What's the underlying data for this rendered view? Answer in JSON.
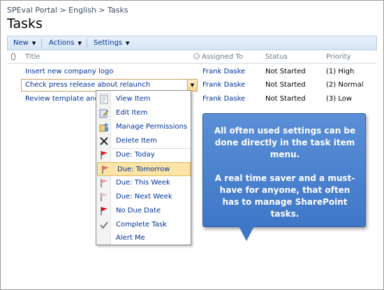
{
  "breadcrumb": "SPEval Portal > English > Tasks",
  "page_title": "Tasks",
  "toolbar": {
    "new_label": "New",
    "actions_label": "Actions",
    "settings_label": "Settings"
  },
  "columns": {
    "title": "Title",
    "assigned_to": "Assigned To",
    "status": "Status",
    "priority": "Priority"
  },
  "rows": [
    {
      "title": "Insert new company logo",
      "assigned_to": "Frank Daske",
      "status": "Not Started",
      "priority": "(1) High"
    },
    {
      "title": "Check press release about relaunch",
      "assigned_to": "Frank Daske",
      "status": "Not Started",
      "priority": "(2) Normal"
    },
    {
      "title": "Review template and CS",
      "assigned_to": "Frank Daske",
      "status": "Not Started",
      "priority": "(3) Low"
    }
  ],
  "menu": {
    "items": [
      {
        "label": "View Item",
        "icon": "view-icon"
      },
      {
        "label": "Edit Item",
        "icon": "edit-icon"
      },
      {
        "label": "Manage Permissions",
        "icon": "permissions-icon"
      },
      {
        "label": "Delete Item",
        "icon": "delete-icon"
      },
      {
        "label": "Due: Today",
        "icon": "flag-red-icon"
      },
      {
        "label": "Due: Tomorrow",
        "icon": "flag-pink-icon"
      },
      {
        "label": "Due: This Week",
        "icon": "flag-pink-icon"
      },
      {
        "label": "Due: Next Week",
        "icon": "flag-pale-icon"
      },
      {
        "label": "No Due Date",
        "icon": "flag-red-icon"
      },
      {
        "label": "Complete Task",
        "icon": "checkmark-icon"
      },
      {
        "label": "Alert Me",
        "icon": "alert-icon"
      }
    ],
    "highlighted_index": 5
  },
  "callout": {
    "paragraph1": "All often used settings can be done directly in the task item menu.",
    "paragraph2": "A real time saver and a must-have for anyone, that often has to manage SharePoint tasks."
  },
  "colors": {
    "link": "#003399",
    "callout": "#4a82d0",
    "highlight": "#fbe4a6"
  }
}
